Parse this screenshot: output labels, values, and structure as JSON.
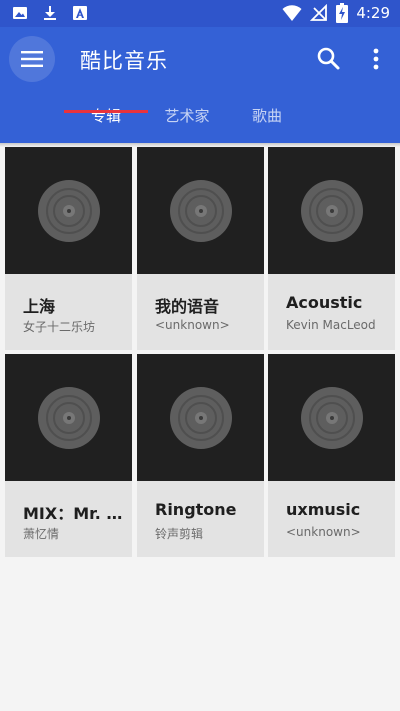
{
  "status_bar": {
    "time": "4:29",
    "left_icons": [
      "image-icon",
      "download-icon",
      "text-a-icon"
    ],
    "right_icons": [
      "wifi-icon",
      "no-signal-icon",
      "battery-charging-icon"
    ]
  },
  "app_bar": {
    "title": "酷比音乐",
    "menu_icon": "hamburger-menu-icon",
    "search_icon": "search-icon",
    "more_icon": "more-vert-icon",
    "color": "#3461d6"
  },
  "tabs": [
    {
      "label": "专辑",
      "active": true
    },
    {
      "label": "艺术家",
      "active": false
    },
    {
      "label": "歌曲",
      "active": false
    }
  ],
  "accent_color": "#e8333d",
  "albums": [
    {
      "title": "上海",
      "artist": "女子十二乐坊"
    },
    {
      "title": "我的语音",
      "artist": "<unknown>"
    },
    {
      "title": "Acoustic",
      "artist": "Kevin MacLeod"
    },
    {
      "title": "MIX：Mr. ...",
      "artist": "萧忆情"
    },
    {
      "title": "Ringtone",
      "artist": "铃声剪辑"
    },
    {
      "title": "uxmusic",
      "artist": "<unknown>"
    }
  ]
}
